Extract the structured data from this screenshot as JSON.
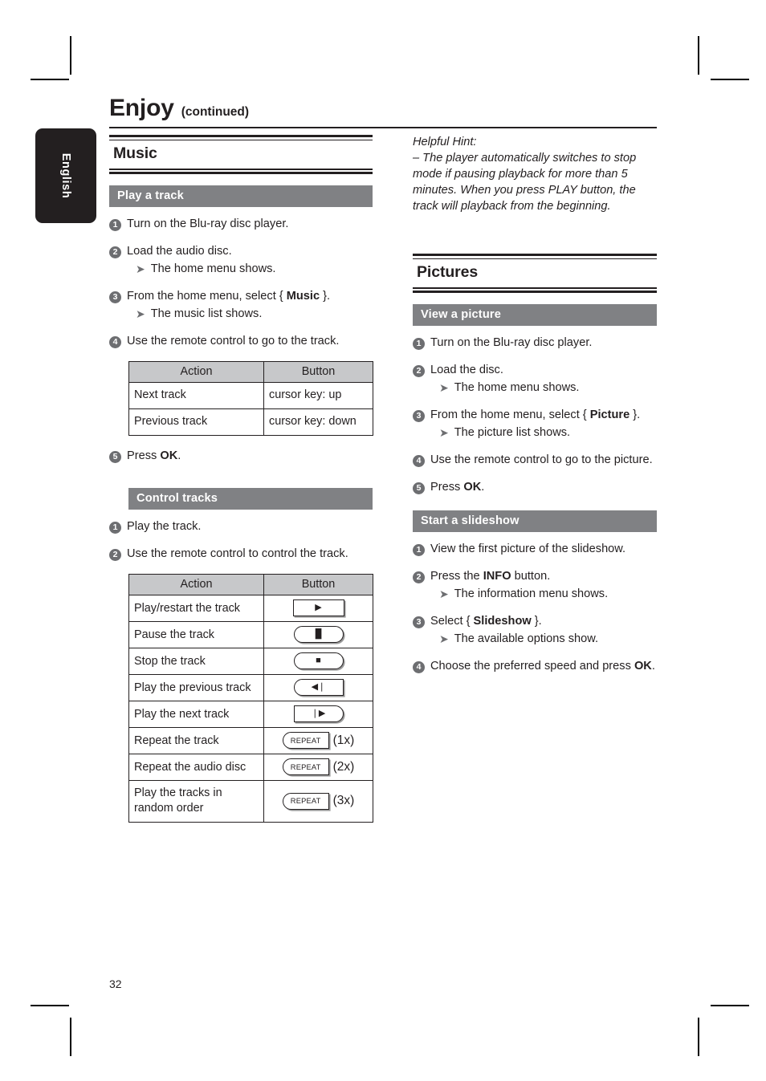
{
  "sidebar": {
    "language_tab": "English"
  },
  "header": {
    "title": "Enjoy",
    "subtitle": "(continued)"
  },
  "page": {
    "number": "32"
  },
  "left_column": {
    "section": {
      "title": "Music"
    },
    "play_track": {
      "bar_label": "Play a track",
      "steps": [
        {
          "num": "1",
          "text": "Turn on the Blu-ray disc player."
        },
        {
          "num": "2",
          "text": "Load the audio disc.",
          "result": "The home menu shows."
        },
        {
          "num": "3",
          "text_pre": "From the home menu, select { ",
          "text_bold": "Music",
          "text_post": " }.",
          "result": "The music list shows."
        },
        {
          "num": "4",
          "text": "Use the remote control to go to the track."
        },
        {
          "num": "5",
          "text_pre": "Press ",
          "text_bold": "OK",
          "text_post": "."
        }
      ],
      "table": {
        "headers": [
          "Action",
          "Button"
        ],
        "rows": [
          {
            "action": "Next track",
            "button": "cursor key: up"
          },
          {
            "action": "Previous track",
            "button": "cursor key: down"
          }
        ]
      }
    },
    "control_tracks": {
      "bar_label": "Control tracks",
      "steps": [
        {
          "num": "1",
          "text": "Play the track."
        },
        {
          "num": "2",
          "text": "Use the remote control to control the track."
        }
      ],
      "table": {
        "headers": [
          "Action",
          "Button"
        ],
        "rows": [
          {
            "action": "Play/restart the track",
            "key_type": "rect",
            "key_icon": "play-icon",
            "glyph": "▶",
            "suffix": ""
          },
          {
            "action": "Pause the track",
            "key_type": "pill",
            "key_icon": "pause-icon",
            "glyph": "▐▌",
            "suffix": ""
          },
          {
            "action": "Stop the track",
            "key_type": "pill",
            "key_icon": "stop-icon",
            "glyph": "■",
            "suffix": ""
          },
          {
            "action": "Play the previous track",
            "key_type": "left",
            "key_icon": "previous-icon",
            "glyph": "◀❘",
            "suffix": ""
          },
          {
            "action": "Play the next track",
            "key_type": "right",
            "key_icon": "next-icon",
            "glyph": "❘▶",
            "suffix": ""
          },
          {
            "action": "Repeat the track",
            "key_type": "repeat",
            "key_icon": "repeat-icon",
            "glyph": "REPEAT",
            "suffix": "(1x)"
          },
          {
            "action": "Repeat the audio disc",
            "key_type": "repeat",
            "key_icon": "repeat-icon",
            "glyph": "REPEAT",
            "suffix": "(2x)"
          },
          {
            "action": "Play the tracks in random order",
            "key_type": "repeat",
            "key_icon": "repeat-icon",
            "glyph": "REPEAT",
            "suffix": "(3x)"
          }
        ]
      }
    }
  },
  "right_column": {
    "hint": {
      "label": "Helpful Hint:",
      "body": "–  The player automatically switches to stop mode if pausing playback for more than 5 minutes.  When you press PLAY button, the track will playback from the beginning."
    },
    "section": {
      "title": "Pictures"
    },
    "view_picture": {
      "bar_label": "View a picture",
      "steps": [
        {
          "num": "1",
          "text": "Turn on the Blu-ray disc player."
        },
        {
          "num": "2",
          "text": "Load the disc.",
          "result": "The home menu shows."
        },
        {
          "num": "3",
          "text_pre": "From the home menu, select { ",
          "text_bold": "Picture",
          "text_post": " }.",
          "result": "The picture list shows."
        },
        {
          "num": "4",
          "text": "Use the remote control to go to the picture."
        },
        {
          "num": "5",
          "text_pre": "Press ",
          "text_bold": "OK",
          "text_post": "."
        }
      ]
    },
    "slideshow": {
      "bar_label": "Start a slideshow",
      "steps": [
        {
          "num": "1",
          "text": "View the first picture of the slideshow."
        },
        {
          "num": "2",
          "text_pre": "Press the ",
          "text_bold": "INFO",
          "text_post": " button.",
          "result": "The information menu shows."
        },
        {
          "num": "3",
          "text_pre": "Select { ",
          "text_bold": "Slideshow",
          "text_post": " }.",
          "result": "The available options show."
        },
        {
          "num": "4",
          "text_pre": "Choose the preferred speed and press ",
          "text_bold": "OK",
          "text_post": "."
        }
      ]
    }
  },
  "colors": {
    "ink": "#231f20",
    "subsection_bar": "#808184",
    "table_header": "#c7c8ca",
    "badge": "#6d6e71"
  }
}
